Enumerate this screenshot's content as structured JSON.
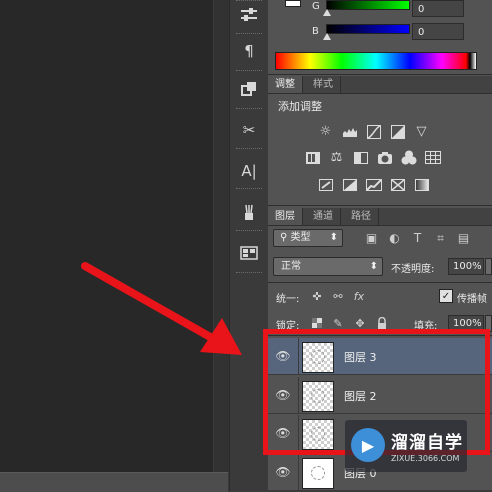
{
  "color_panel": {
    "g_label": "G",
    "g_value": "0",
    "b_label": "B",
    "b_value": "0"
  },
  "adjustments_panel": {
    "tabs": [
      {
        "label": "调整",
        "active": true
      },
      {
        "label": "样式",
        "active": false
      }
    ],
    "title": "添加调整",
    "row1_icons": [
      "brightness-contrast-icon",
      "levels-icon",
      "curves-icon",
      "exposure-icon",
      "vibrance-icon"
    ],
    "row2_icons": [
      "hue-saturation-icon",
      "color-balance-icon",
      "black-white-icon",
      "photo-filter-icon",
      "channel-mixer-icon",
      "color-lookup-icon"
    ],
    "row3_icons": [
      "invert-icon",
      "posterize-icon",
      "threshold-icon",
      "selective-color-icon",
      "gradient-map-icon"
    ]
  },
  "layers_panel": {
    "tabs": [
      {
        "label": "图层",
        "active": true
      },
      {
        "label": "通道",
        "active": false
      },
      {
        "label": "路径",
        "active": false
      }
    ],
    "filter": {
      "search_glyph": "⚲",
      "label": "类型",
      "arrows": "⬍"
    },
    "blend_mode": {
      "label": "正常",
      "arrows": "⬍"
    },
    "opacity_label": "不透明度:",
    "opacity_value": "100%",
    "unify_label": "统一:",
    "unify_fx": "fx",
    "propagate_label": "传播帧",
    "propagate_checked": true,
    "lock_label": "锁定:",
    "fill_label": "填充:",
    "fill_value": "100%",
    "layers": [
      {
        "name": "图层 3",
        "visible": true,
        "selected": true
      },
      {
        "name": "图层 2",
        "visible": true,
        "selected": false
      },
      {
        "name": "",
        "visible": true,
        "selected": false
      },
      {
        "name": "图层 0",
        "visible": true,
        "selected": false
      }
    ]
  },
  "watermark": {
    "main": "溜溜自学",
    "sub": "ZIXUE.3066.COM"
  },
  "colors": {
    "annotation_red": "#e8141a",
    "selected_layer": "#56657b",
    "panel_bg": "#535353"
  }
}
